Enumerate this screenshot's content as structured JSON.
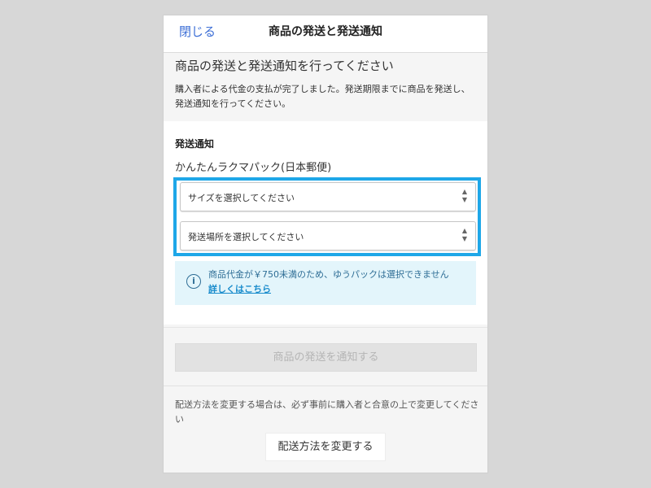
{
  "header": {
    "close_label": "閉じる",
    "title": "商品の発送と発送通知"
  },
  "intro": {
    "heading": "商品の発送と発送通知を行ってください",
    "body": "購入者による代金の支払が完了しました。発送期限までに商品を発送し、発送通知を行ってください。"
  },
  "form": {
    "section_title": "発送通知",
    "method": "かんたんラクマパック(日本郵便)",
    "size_select": {
      "placeholder": "サイズを選択してください"
    },
    "place_select": {
      "placeholder": "発送場所を選択してください"
    },
    "highlight_color": "#1ea7e8"
  },
  "notice": {
    "icon": "info-icon",
    "text": "商品代金が￥750未満のため、ゆうパックは選択できません",
    "link_label": "詳しくはこちら"
  },
  "actions": {
    "notify_label": "商品の発送を通知する",
    "change_note": "配送方法を変更する場合は、必ず事前に購入者と合意の上で変更してください",
    "change_label": "配送方法を変更する"
  }
}
